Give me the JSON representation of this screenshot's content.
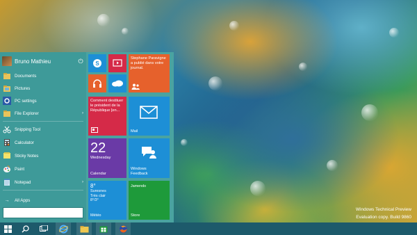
{
  "user": {
    "name": "Bruno Mathieu"
  },
  "menu": [
    {
      "label": "Documents",
      "icon": "folder-icon",
      "arrow": ""
    },
    {
      "label": "Pictures",
      "icon": "folder-icon",
      "arrow": ""
    },
    {
      "label": "PC settings",
      "icon": "gear-icon",
      "arrow": ""
    },
    {
      "label": "File Explorer",
      "icon": "folder-icon",
      "arrow": "›"
    },
    {
      "label": "Snipping Tool",
      "icon": "scissors-icon",
      "arrow": ""
    },
    {
      "label": "Calculator",
      "icon": "calculator-icon",
      "arrow": ""
    },
    {
      "label": "Sticky Notes",
      "icon": "sticky-note-icon",
      "arrow": ""
    },
    {
      "label": "Paint",
      "icon": "paint-icon",
      "arrow": ""
    },
    {
      "label": "Notepad",
      "icon": "notepad-icon",
      "arrow": "›"
    }
  ],
  "all_apps": "All Apps",
  "tiles": {
    "contact_name": "Stephane Paravigne a publié dans votre journal.",
    "news": "Comment destituer le président de la République [en...",
    "mail": "Mail",
    "calendar_day": "22",
    "calendar_weekday": "Wednesday",
    "calendar": "Calendar",
    "feedback": "Windows Feedback",
    "weather_temp": "8°",
    "weather_city": "Suresnes",
    "weather_cond": "Très clair",
    "weather_range": "8°/3°",
    "weather": "Météo",
    "jamendo": "Jamendo",
    "store": "Store"
  },
  "watermark": {
    "line1": "Windows Technical Preview",
    "line2": "Evaluation copy. Build 9860"
  },
  "colors": {
    "start_bg": "#4aa3a0",
    "tile_blue": "#1d8fd6",
    "tile_red": "#d52a48",
    "tile_orange": "#e6612c",
    "tile_purple": "#6a3aa6",
    "tile_green": "#1e9a3a"
  }
}
